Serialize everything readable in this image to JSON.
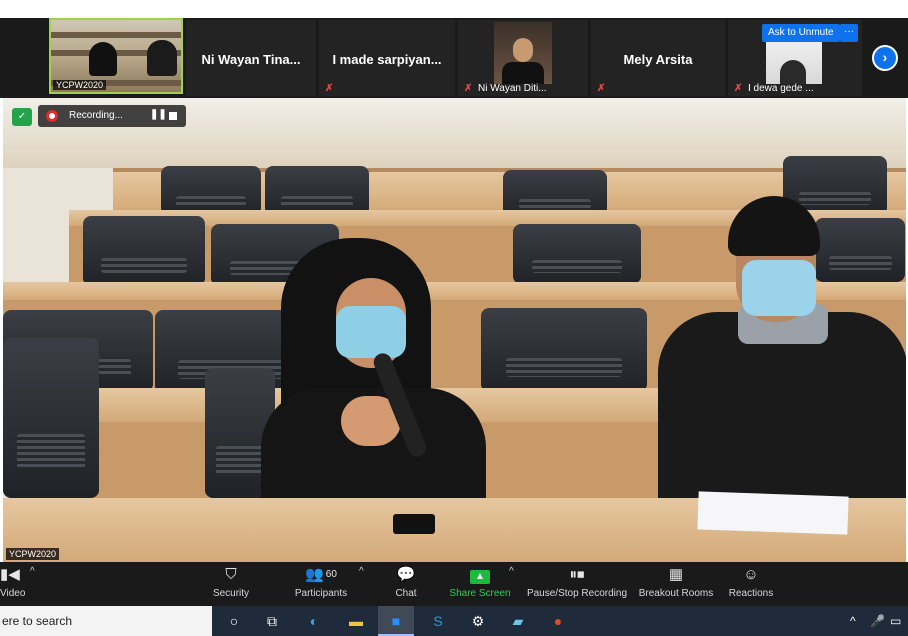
{
  "participants_strip": {
    "self_tile": {
      "camera_tag": "YCPW2020",
      "muted": true
    },
    "name_tiles": [
      {
        "name": "Ni Wayan Tina...",
        "muted": true
      },
      {
        "name": "I made sarpiyan...",
        "muted": true
      },
      {
        "name": "Ni Wayan Diti...",
        "muted": true
      },
      {
        "name": "Mely Arsita",
        "muted": true
      },
      {
        "name": "I dewa gede ...",
        "muted": true
      }
    ],
    "ask_to_unmute": "Ask to Unmute",
    "more_options": "···",
    "next_icon": "chevron-right-icon"
  },
  "recording": {
    "label": "Recording...",
    "pause_icon": "pause-icon",
    "stop_icon": "stop-icon"
  },
  "main_video": {
    "camera_tag": "YCPW2020"
  },
  "toolbar": {
    "video": "Video",
    "security": "Security",
    "participants": "Participants",
    "participants_count": "60",
    "chat": "Chat",
    "share_screen": "Share Screen",
    "pause_stop_recording": "Pause/Stop Recording",
    "breakout_rooms": "Breakout Rooms",
    "reactions": "Reactions"
  },
  "taskbar": {
    "search_placeholder": "ere to search",
    "apps": [
      "cortana-icon",
      "task-view-icon",
      "edge-icon",
      "file-explorer-icon",
      "zoom-icon",
      "skype-icon",
      "settings-icon",
      "notepad-icon",
      "powerpoint-icon"
    ]
  },
  "colors": {
    "toolbar_bg": "#1a1a1a",
    "zoom_blue": "#0e72ed",
    "share_green": "#1fba3b",
    "mute_red": "#e64646"
  }
}
